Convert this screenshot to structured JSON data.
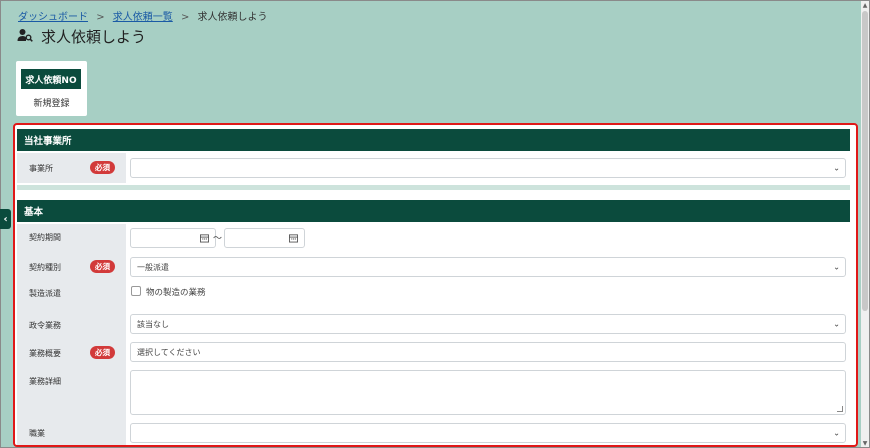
{
  "breadcrumb": {
    "items": [
      "ダッシュボード",
      "求人依頼一覧",
      "求人依頼しよう"
    ],
    "separator": ">"
  },
  "page": {
    "title": "求人依頼しよう",
    "title_icon": "user-search-icon"
  },
  "request_no": {
    "label": "求人依頼NO",
    "value": "新規登録"
  },
  "sections": {
    "office": {
      "title": "当社事業所",
      "fields": {
        "office": {
          "label": "事業所",
          "required": "必須",
          "value": ""
        }
      }
    },
    "basic": {
      "title": "基本",
      "fields": {
        "contract_period": {
          "label": "契約期間",
          "from": "",
          "to": "",
          "separator": "～"
        },
        "contract_type": {
          "label": "契約種別",
          "required": "必須",
          "value": "一般派遣"
        },
        "manufacturing": {
          "label": "製造派遣",
          "checkbox_label": "物の製造の業務",
          "checked": false
        },
        "ordinance_work": {
          "label": "政令業務",
          "value": "該当なし"
        },
        "work_summary": {
          "label": "業務概要",
          "required": "必須",
          "placeholder": "選択してください"
        },
        "work_detail": {
          "label": "業務詳細",
          "value": ""
        },
        "occupation": {
          "label": "職業",
          "value": ""
        }
      }
    }
  },
  "colors": {
    "background": "#a7cfc4",
    "header_green": "#0b4b3d",
    "required_red": "#d23a3a",
    "highlight_border": "#e01818",
    "link_blue": "#1a5aa5"
  },
  "icons": {
    "calendar": "calendar-icon",
    "chevron": "chevron-down-icon",
    "sidebar_toggle": "chevron-left-icon"
  }
}
